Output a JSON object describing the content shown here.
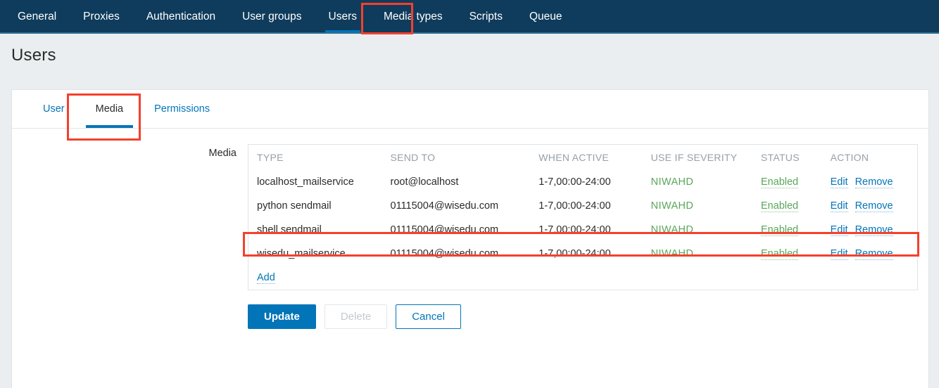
{
  "topnav": {
    "items": [
      {
        "label": "General",
        "active": false
      },
      {
        "label": "Proxies",
        "active": false
      },
      {
        "label": "Authentication",
        "active": false
      },
      {
        "label": "User groups",
        "active": false
      },
      {
        "label": "Users",
        "active": true
      },
      {
        "label": "Media types",
        "active": false
      },
      {
        "label": "Scripts",
        "active": false
      },
      {
        "label": "Queue",
        "active": false
      }
    ]
  },
  "page": {
    "title": "Users"
  },
  "subtabs": [
    {
      "label": "User",
      "active": false
    },
    {
      "label": "Media",
      "active": true
    },
    {
      "label": "Permissions",
      "active": false
    }
  ],
  "form": {
    "media_label": "Media"
  },
  "media_table": {
    "headers": [
      "TYPE",
      "SEND TO",
      "WHEN ACTIVE",
      "USE IF SEVERITY",
      "STATUS",
      "ACTION"
    ],
    "rows": [
      {
        "type": "localhost_mailservice",
        "send_to": "root@localhost",
        "when_active": "1-7,00:00-24:00",
        "severity": "NIWAHD",
        "status": "Enabled",
        "edit": "Edit",
        "remove": "Remove",
        "highlighted": false
      },
      {
        "type": "python sendmail",
        "send_to": "01115004@wisedu.com",
        "when_active": "1-7,00:00-24:00",
        "severity": "NIWAHD",
        "status": "Enabled",
        "edit": "Edit",
        "remove": "Remove",
        "highlighted": false
      },
      {
        "type": "shell sendmail",
        "send_to": "01115004@wisedu.com",
        "when_active": "1-7,00:00-24:00",
        "severity": "NIWAHD",
        "status": "Enabled",
        "edit": "Edit",
        "remove": "Remove",
        "highlighted": true
      },
      {
        "type": "wisedu_mailservice",
        "send_to": "01115004@wisedu.com",
        "when_active": "1-7,00:00-24:00",
        "severity": "NIWAHD",
        "status": "Enabled",
        "edit": "Edit",
        "remove": "Remove",
        "highlighted": false
      }
    ],
    "add_label": "Add"
  },
  "buttons": {
    "update": "Update",
    "delete": "Delete",
    "cancel": "Cancel"
  },
  "colors": {
    "nav_bg": "#0f3c5c",
    "accent_blue": "#0275b8",
    "status_green": "#59a659",
    "annotation_red": "#f5402c",
    "page_bg": "#ebeef0"
  }
}
